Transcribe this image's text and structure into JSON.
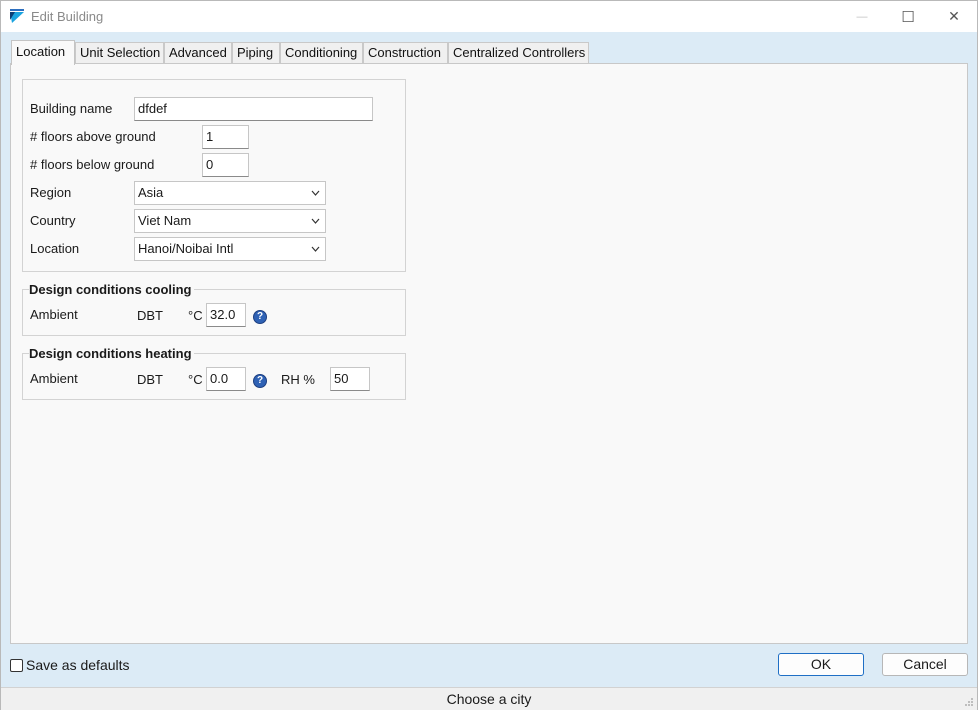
{
  "window": {
    "title": "Edit Building"
  },
  "titlebar": {
    "minimize_glyph": "—",
    "maximize_glyph": "☐",
    "close_glyph": "✕"
  },
  "tabs": [
    {
      "label": "Location",
      "active": true
    },
    {
      "label": "Unit Selection",
      "active": false
    },
    {
      "label": "Advanced",
      "active": false
    },
    {
      "label": "Piping",
      "active": false
    },
    {
      "label": "Conditioning",
      "active": false
    },
    {
      "label": "Construction",
      "active": false
    },
    {
      "label": "Centralized Controllers",
      "active": false
    }
  ],
  "location": {
    "building_name_label": "Building name",
    "building_name_value": "dfdef",
    "floors_above_label": "# floors above ground",
    "floors_above_value": "1",
    "floors_below_label": "# floors below ground",
    "floors_below_value": "0",
    "region_label": "Region",
    "region_value": "Asia",
    "country_label": "Country",
    "country_value": "Viet Nam",
    "location_label": "Location",
    "location_value": "Hanoi/Noibai Intl"
  },
  "cooling": {
    "title": "Design conditions cooling",
    "ambient_label": "Ambient",
    "dbt_label": "DBT",
    "unit_label": "°C",
    "dbt_value": "32.0",
    "help_glyph": "?"
  },
  "heating": {
    "title": "Design conditions heating",
    "ambient_label": "Ambient",
    "dbt_label": "DBT",
    "unit_label": "°C",
    "dbt_value": "0.0",
    "help_glyph": "?",
    "rh_label": "RH %",
    "rh_value": "50"
  },
  "footer": {
    "save_defaults_label": "Save as defaults",
    "save_defaults_checked": false,
    "ok_label": "OK",
    "cancel_label": "Cancel"
  },
  "status": {
    "text": "Choose a city"
  },
  "colors": {
    "accent": "#1f6fc5",
    "chrome": "#dcebf6",
    "panel": "#f9f9f9",
    "help": "#2f62b5"
  }
}
